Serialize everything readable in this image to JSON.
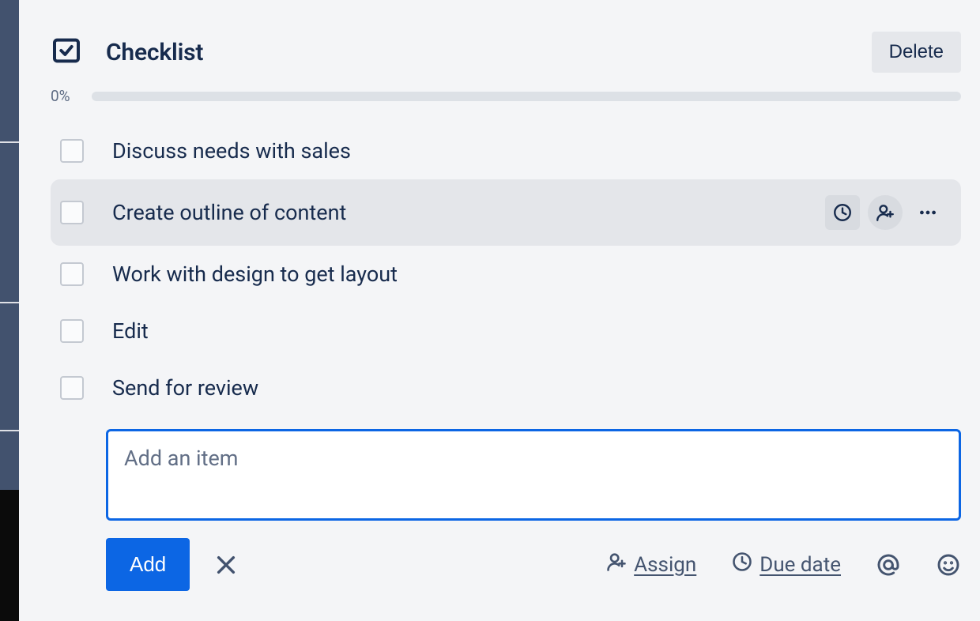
{
  "header": {
    "title": "Checklist",
    "delete_label": "Delete"
  },
  "progress": {
    "percent_label": "0%",
    "percent_value": 0
  },
  "items": [
    {
      "label": "Discuss needs with sales",
      "checked": false,
      "hovered": false
    },
    {
      "label": "Create outline of content",
      "checked": false,
      "hovered": true
    },
    {
      "label": "Work with design to get layout",
      "checked": false,
      "hovered": false
    },
    {
      "label": "Edit",
      "checked": false,
      "hovered": false
    },
    {
      "label": "Send for review",
      "checked": false,
      "hovered": false
    }
  ],
  "add": {
    "placeholder": "Add an item",
    "submit_label": "Add",
    "assign_label": "Assign",
    "due_date_label": "Due date"
  },
  "icons": {
    "checklist": "checklist-icon",
    "clock": "clock-icon",
    "assign_member": "person-add-icon",
    "more": "more-icon",
    "cancel": "close-icon",
    "mention": "at-icon",
    "emoji": "emoji-icon"
  }
}
